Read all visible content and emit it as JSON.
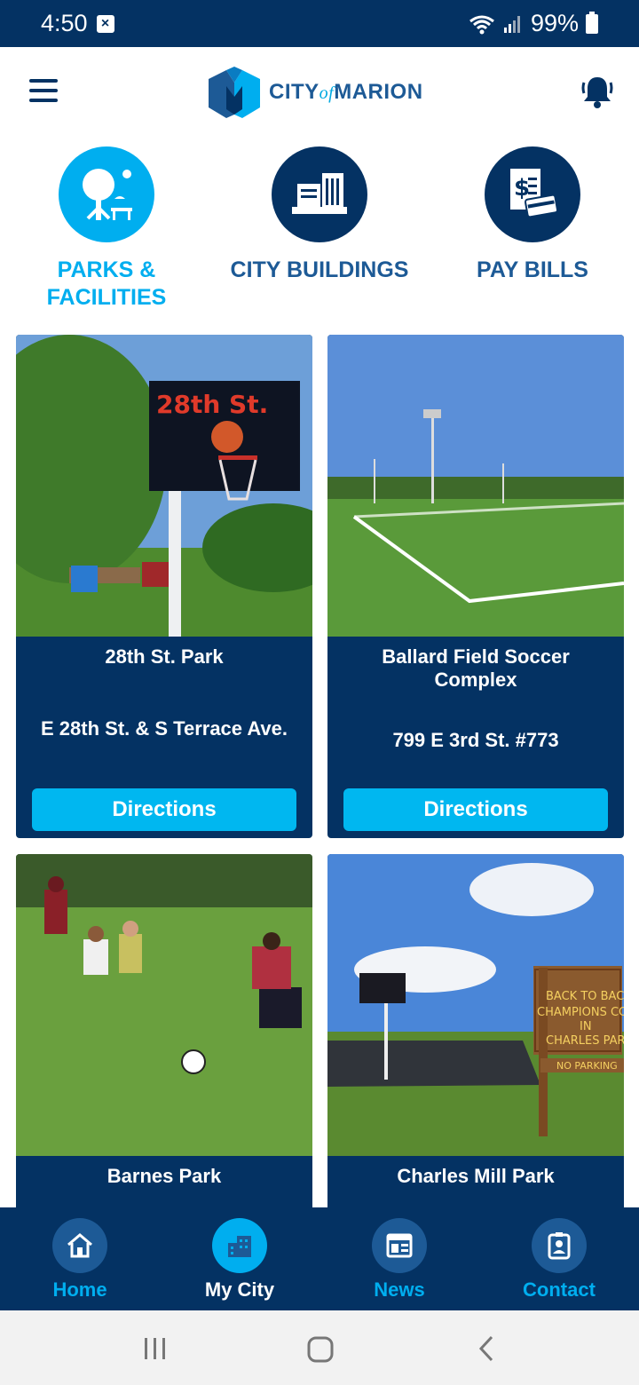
{
  "status_bar": {
    "time": "4:50",
    "battery": "99%"
  },
  "header": {
    "logo_city": "CITY",
    "logo_of": "of",
    "logo_marion": "MARION"
  },
  "categories": [
    {
      "line1": "PARKS &",
      "line2": "FACILITIES",
      "active": true
    },
    {
      "line1": "CITY BUILDINGS",
      "line2": "",
      "active": false
    },
    {
      "line1": "PAY BILLS",
      "line2": "",
      "active": false
    }
  ],
  "cards": [
    {
      "title": "28th St. Park",
      "address": "E 28th St. & S Terrace Ave.",
      "button": "Directions",
      "sign_text": "28th St."
    },
    {
      "title": "Ballard Field Soccer Complex",
      "address": "799 E 3rd St. #773",
      "button": "Directions"
    },
    {
      "title": "Barnes Park"
    },
    {
      "title": "Charles Mill Park",
      "sign_lines": [
        "BACK TO BACK",
        "CHAMPIONS COU",
        "IN",
        "CHARLES PARK",
        "NO PARKING"
      ]
    }
  ],
  "bottom_nav": [
    {
      "label": "Home",
      "icon": "home-icon"
    },
    {
      "label": "My City",
      "icon": "city-icon",
      "active": true
    },
    {
      "label": "News",
      "icon": "news-icon"
    },
    {
      "label": "Contact",
      "icon": "contact-icon"
    }
  ],
  "colors": {
    "navy": "#043263",
    "accent": "#00aeef",
    "button": "#00b7f0"
  }
}
